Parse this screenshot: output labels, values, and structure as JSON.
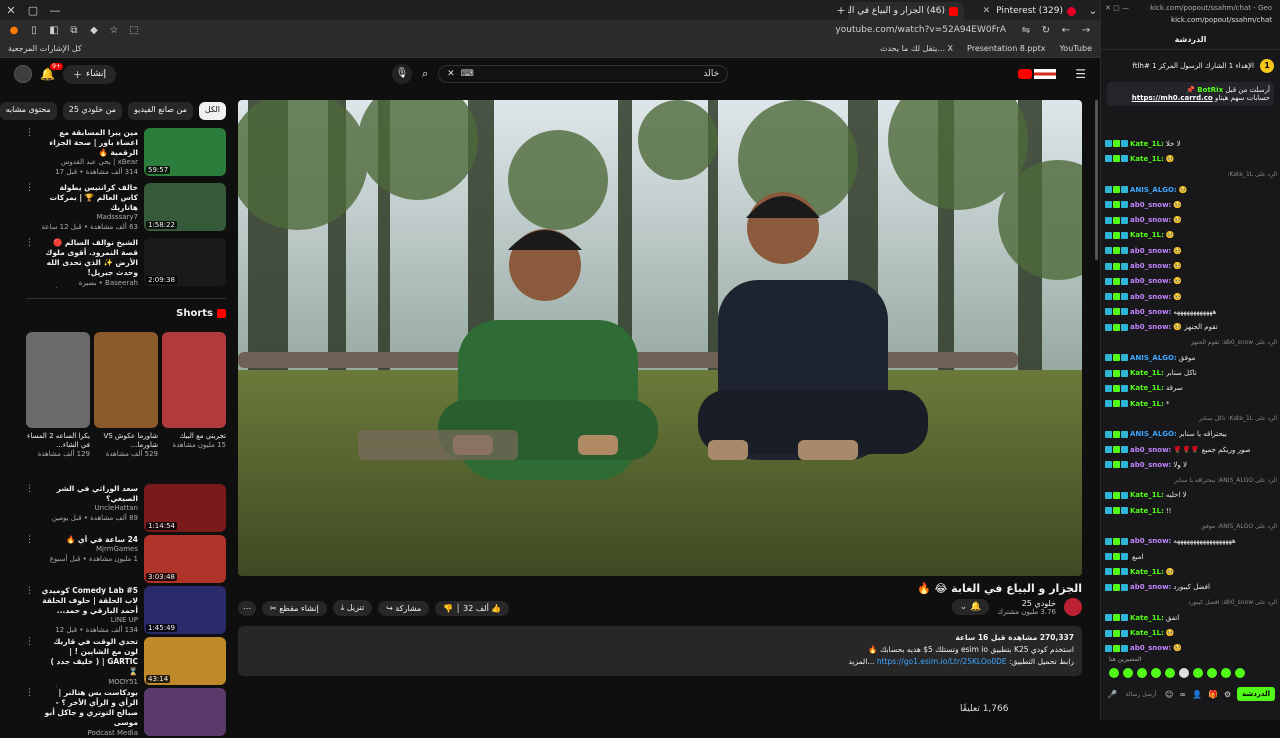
{
  "yt_browser": {
    "tabs": [
      {
        "label": "(46) الجزار و البياع في الغابة 🔥"
      },
      {
        "label": "(329) Pinterest"
      }
    ],
    "url": "youtube.com/watch?v=52A94EW0FrA",
    "bookmarks": {
      "all_label": "كل الإشارات المرجعية",
      "items": [
        "يتقل لك ما يحدث... X",
        "Presentation 8.pptx",
        "YouTube"
      ]
    }
  },
  "yt_header": {
    "notif_count": "9+",
    "create_label": "إنشاء",
    "search_query": "خالد"
  },
  "chips": [
    "الكل",
    "من صانع الفيديو",
    "من خلودي 25",
    "محتوى مشابه"
  ],
  "recs_top": [
    {
      "title": "مين يبرا المسابقة مع اعضاء باور | صحة الجزاء الرقمية 🔥",
      "channel": "xBear | يحي عبد القدوس",
      "views": "314 ألف مشاهدة • قبل 17 ساعة",
      "duration": "59:57",
      "color": "#2a7d3a"
    },
    {
      "title": "خالف كرانتيس يطولة كاس العالم 🏆 | بمركات هاتاريك",
      "channel": "Madsssary7",
      "views": "63 ألف مشاهدة • قبل 12 ساعة",
      "duration": "1:58:22",
      "color": "#355a3a"
    },
    {
      "title": "الشيخ نوالف السالم 🔴 قصة النمرود. أقوى ملوك الأرض ✨ الذي تحدى الله وحدث جبريل!",
      "channel": "Baseerah • بصيرة",
      "views": "148 ألف مشاهدة • قبل 4 أيام",
      "duration": "2:09:38",
      "color": "#1a1a1a"
    }
  ],
  "shorts_label": "Shorts",
  "shorts": [
    {
      "title": "تجربتي مع البيك",
      "views": "15 مليون مشاهدة",
      "color": "#b33a3a"
    },
    {
      "title": "شاورما عكوش VS شاورما...",
      "views": "529 ألف مشاهدة",
      "color": "#8a5a2a"
    },
    {
      "title": "يكرا الساعه 2 المساء في الشاء...",
      "views": "129 ألف مشاهدة",
      "color": "#6a6a6a"
    }
  ],
  "recs_bottom": [
    {
      "title": "سعد الوراثي في الشر الصيغي؟",
      "channel": "UncleHattan",
      "views": "89 ألف مشاهدة • قبل يومين",
      "duration": "1:14:54",
      "color": "#7a1a1a"
    },
    {
      "title": "24 ساعة في أي 🔥",
      "channel": "MjrmGames",
      "views": "1 مليون مشاهدة • قبل أسبوع",
      "duration": "3:03:48",
      "color": "#b0342a"
    },
    {
      "title": "Comedy Lab #5 كوميدي لاب الحلقة | حلوف الحلقة أحمد البارقي و حمد...",
      "channel": "LINE UP",
      "views": "134 ألف مشاهدة • قبل 12 ساعة",
      "duration": "1:45:49",
      "color": "#2a2a6a"
    },
    {
      "title": "تحدي الوقت في قاربك لون مع الشايين ! | GARTIC | ( خليف جدد ) ⌛",
      "channel": "MODY51",
      "views": "140 ألف مشاهدة • قبل 3 أيام",
      "duration": "43:14",
      "color": "#c08a2a"
    },
    {
      "title": "بودكاست بس هتالنر | الرأي و الرأي الأخر ؟ - صبالح التوتري و جاكل أبو موسى",
      "channel": "Podcast Media",
      "views": "",
      "duration": "",
      "color": "#5a3a6a"
    }
  ],
  "video": {
    "title": "الجزار و البياع في الغابة 😂 🔥",
    "channel": "خلودي 25",
    "subs": "3.76 مليون مشترك",
    "like_count": "32 ألف",
    "share_label": "مشاركة",
    "download_label": "تنزيل",
    "clip_label": "إنشاء مقطع",
    "stats": "270,337 مشاهدة قبل 16 ساعة",
    "desc_line": "استخدم كودي K25 بتطبيق esim io وتستلك 5$ هديه بحسابك 🔥",
    "desc_link_label": "رابط تحميل التطبيق:",
    "desc_link": "https://go1.esim.io/Ltr/25KLOo0DE",
    "more": "...المزيد",
    "comments_peek": "1,766 تعليقًا"
  },
  "kick": {
    "top_url": "kick.com/popout/ssahm/chat - Geo",
    "addr": "kick.com/popout/ssahm/chat",
    "title": "الدردشة",
    "pin_text": "الإهداء 1 الشارك الرسول المركز 1 #ftlh",
    "pin_rank": "1",
    "pinned_user": "BotRix",
    "pinned_from": "أرسلت من قبل",
    "pinned_text": "حسابات سهم هيتاو",
    "pinned_link": "https://mh0.carrd.co",
    "messages": [
      {
        "user": "Kate_1L:",
        "color": "#53fc18",
        "text": "لا خلا"
      },
      {
        "user": "Kate_1L:",
        "color": "#53fc18",
        "text": "🥺"
      },
      {
        "reply": "الرد على Kate_1L:"
      },
      {
        "user": "ANIS_ALGO:",
        "color": "#3ea6ff",
        "text": "🥺"
      },
      {
        "user": "ab0_snow:",
        "color": "#c084fc",
        "text": "🥺"
      },
      {
        "user": "ab0_snow:",
        "color": "#c084fc",
        "text": "🥺"
      },
      {
        "user": "Kate_1L:",
        "color": "#53fc18",
        "text": "🥺"
      },
      {
        "user": "ab0_snow:",
        "color": "#c084fc",
        "text": "🥺"
      },
      {
        "user": "ab0_snow:",
        "color": "#c084fc",
        "text": "🥺"
      },
      {
        "user": "ab0_snow:",
        "color": "#c084fc",
        "text": "🥺"
      },
      {
        "user": "ab0_snow:",
        "color": "#c084fc",
        "text": "🥺"
      },
      {
        "user": "ab0_snow:",
        "color": "#c084fc",
        "text": "ههههههههههههه"
      },
      {
        "user": "ab0_snow:",
        "color": "#c084fc",
        "text": "تقوم الجنهز 🥺"
      },
      {
        "reply": "الرد على ab0_snow: تقوم الجنهز"
      },
      {
        "user": "ANIS_ALGO:",
        "color": "#3ea6ff",
        "text": "موفق"
      },
      {
        "user": "Kate_1L:",
        "color": "#53fc18",
        "text": "تاكل سنابر"
      },
      {
        "user": "Kate_1L:",
        "color": "#53fc18",
        "text": "سرقة"
      },
      {
        "user": "Kate_1L:",
        "color": "#53fc18",
        "text": "*"
      },
      {
        "reply": "الرد على Kate_1L: تاكل سنابر"
      },
      {
        "user": "ANIS_ALGO:",
        "color": "#3ea6ff",
        "text": "بيحتراقه يا سنابر"
      },
      {
        "user": "ab0_snow:",
        "color": "#c084fc",
        "text": "صور وريكم جميع 🌹🌹🌹"
      },
      {
        "user": "ab0_snow:",
        "color": "#c084fc",
        "text": "لا ولا"
      },
      {
        "reply": "الرد على ANIS_ALGO: بيحتراقه يا سنابر"
      },
      {
        "user": "Kate_1L:",
        "color": "#53fc18",
        "text": "لا اخليه"
      },
      {
        "user": "Kate_1L:",
        "color": "#53fc18",
        "text": "!!"
      },
      {
        "reply": "الرد على ANIS_ALGO: موفق"
      },
      {
        "user": "ab0_snow:",
        "color": "#c084fc",
        "text": "ههههههههههههههههههه"
      },
      {
        "user": "",
        "color": "#aaa",
        "text": "امبع"
      },
      {
        "user": "Kate_1L:",
        "color": "#53fc18",
        "text": "🥺"
      },
      {
        "user": "ab0_snow:",
        "color": "#c084fc",
        "text": "افضل كيبورد"
      },
      {
        "reply": "الرد على ab0_snow: افضل كيبورد"
      },
      {
        "user": "Kate_1L:",
        "color": "#53fc18",
        "text": "اتفق"
      },
      {
        "user": "Kate_1L:",
        "color": "#53fc18",
        "text": "🥺"
      },
      {
        "user": "ab0_snow:",
        "color": "#c084fc",
        "text": "🥺"
      },
      {
        "user": "Kate_1L:",
        "color": "#53fc18",
        "text": "🥺"
      },
      {
        "user": "Kate_1L:",
        "color": "#53fc18",
        "text": "عم التشمع سوالف و لا بش"
      },
      {
        "user": "Kate_1L:",
        "color": "#53fc18",
        "text": "؟"
      },
      {
        "user": "Kate_1L:",
        "color": "#53fc18",
        "text": "🥺"
      }
    ],
    "note": "المتميزين هنا",
    "input_placeholder": "أرسل رسالة",
    "send_label": "الدردشة"
  }
}
